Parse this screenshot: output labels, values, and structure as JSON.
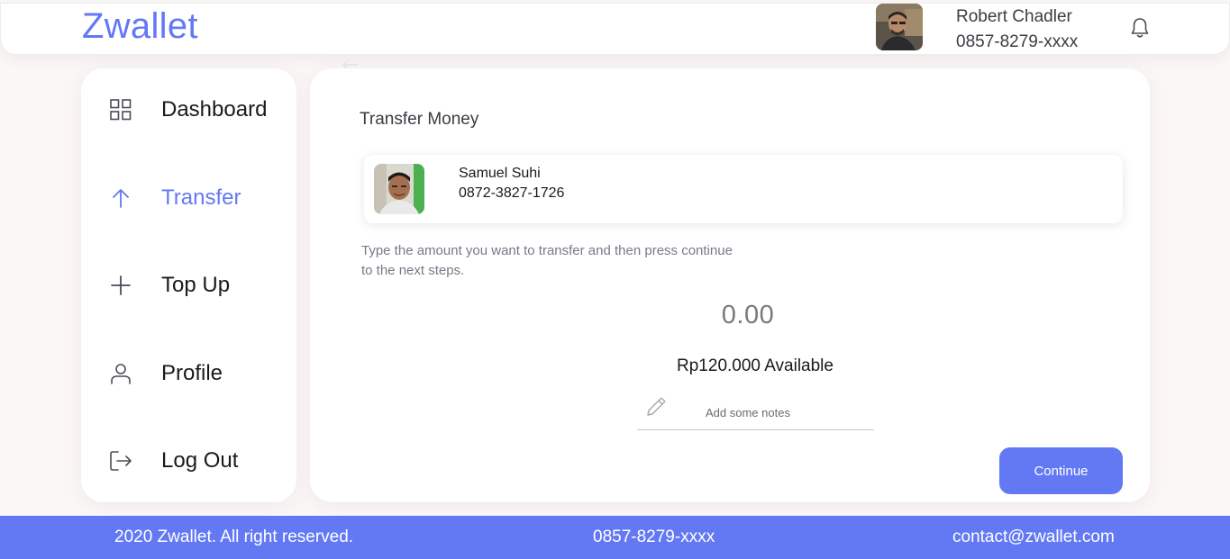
{
  "header": {
    "brand": "Zwallet",
    "user_name": "Robert Chadler",
    "user_phone": "0857-8279-xxxx",
    "avatar_icon": "user-photo",
    "notification_icon": "bell-icon"
  },
  "sidebar": {
    "items": [
      {
        "label": "Dashboard",
        "icon": "grid-icon",
        "active": false
      },
      {
        "label": "Transfer",
        "icon": "arrow-up-icon",
        "active": true
      },
      {
        "label": "Top Up",
        "icon": "plus-icon",
        "active": false
      },
      {
        "label": "Profile",
        "icon": "user-icon",
        "active": false
      },
      {
        "label": "Log Out",
        "icon": "logout-icon",
        "active": false
      }
    ]
  },
  "transfer": {
    "title": "Transfer Money",
    "receiver": {
      "name": "Samuel Suhi",
      "phone": "0872-3827-1726"
    },
    "instructions": "Type the amount you want to transfer and then press continue to the next steps.",
    "amount": "0.00",
    "available": "Rp120.000 Available",
    "notes_placeholder": "Add some notes",
    "notes_value": "",
    "continue_label": "Continue"
  },
  "footer": {
    "copyright": "2020 Zwallet. All right reserved.",
    "phone": "0857-8279-xxxx",
    "email": "contact@zwallet.com"
  },
  "colors": {
    "primary": "#6379F4",
    "background": "#FBF7F7",
    "text": "#3A3D42",
    "muted": "#7A7886"
  }
}
